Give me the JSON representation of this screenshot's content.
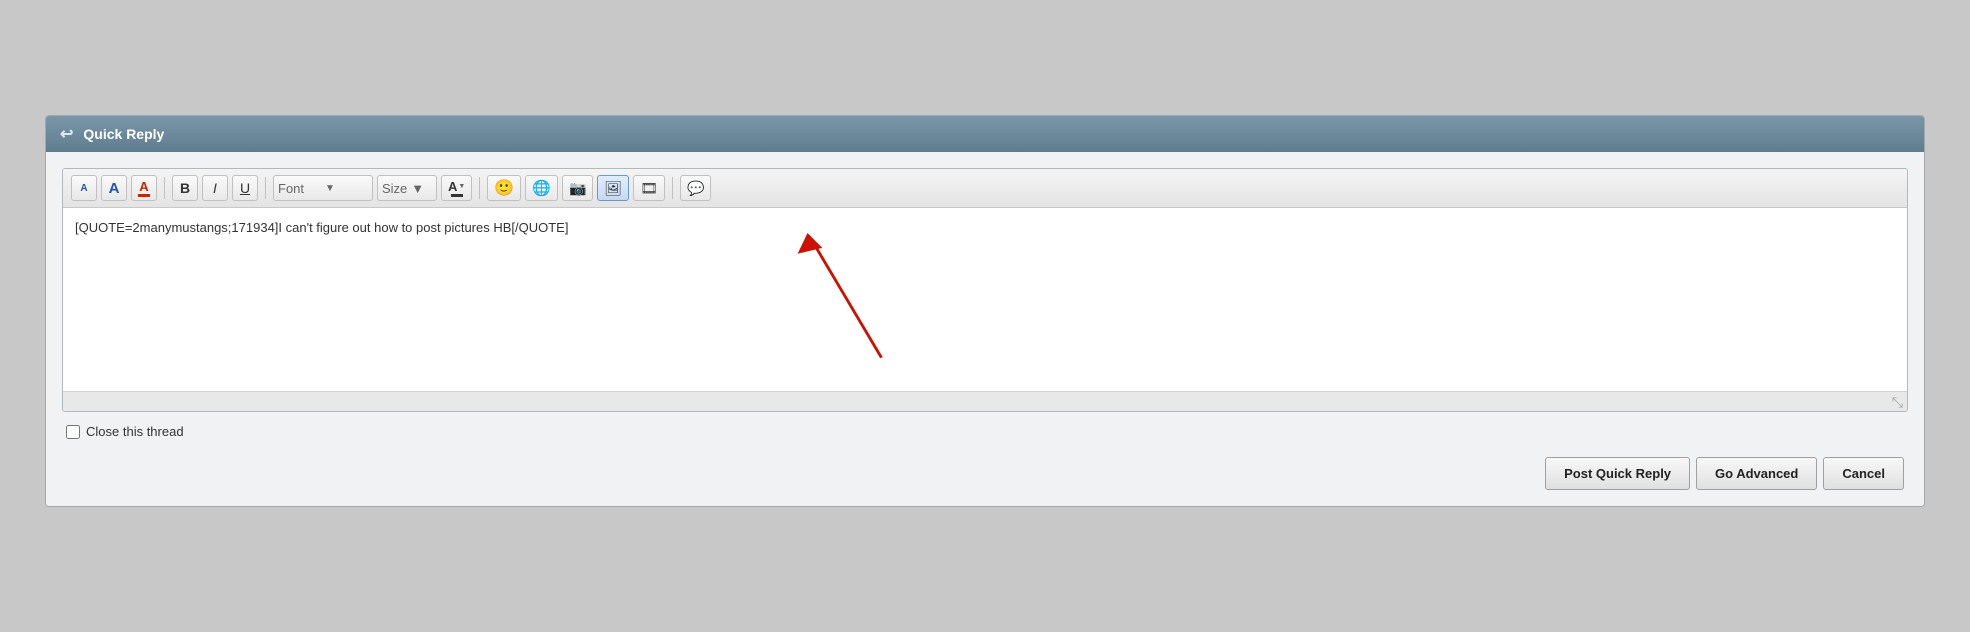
{
  "header": {
    "icon": "↩",
    "title": "Quick Reply"
  },
  "toolbar": {
    "font_label": "Font",
    "size_label": "Size",
    "buttons": [
      {
        "name": "font-size-decrease",
        "label": "A",
        "type": "font-small-blue"
      },
      {
        "name": "font-size-increase",
        "label": "A",
        "type": "font-large-blue"
      },
      {
        "name": "font-color-red",
        "label": "A",
        "type": "font-red"
      },
      {
        "name": "bold",
        "label": "B"
      },
      {
        "name": "italic",
        "label": "I"
      },
      {
        "name": "underline",
        "label": "U"
      },
      {
        "name": "font-dropdown",
        "label": "Font"
      },
      {
        "name": "size-dropdown",
        "label": "Size"
      },
      {
        "name": "font-color",
        "label": "A"
      },
      {
        "name": "emoji",
        "label": "😊"
      },
      {
        "name": "globe",
        "label": "🌐"
      },
      {
        "name": "image-upload",
        "label": "📷"
      },
      {
        "name": "insert-image",
        "label": "🖼"
      },
      {
        "name": "video",
        "label": "🎬"
      },
      {
        "name": "comment",
        "label": "💬"
      }
    ]
  },
  "editor": {
    "content": "[QUOTE=2manymustangs;171934]I can't figure out how to post pictures HB[/QUOTE]",
    "placeholder": ""
  },
  "footer": {
    "close_thread_label": "Close this thread"
  },
  "buttons": {
    "post_quick_reply": "Post Quick Reply",
    "go_advanced": "Go Advanced",
    "cancel": "Cancel"
  }
}
